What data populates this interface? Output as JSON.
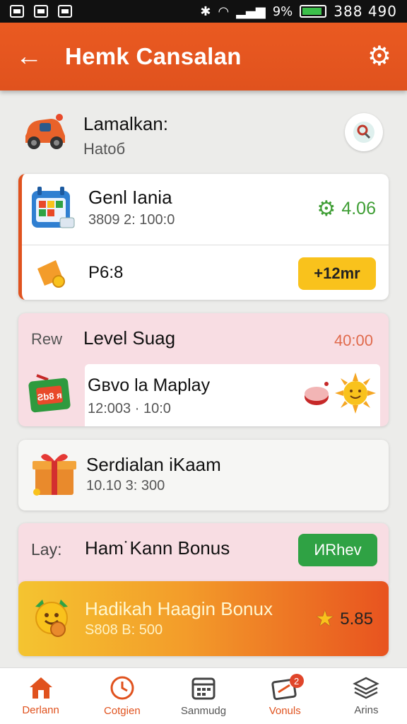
{
  "status_bar": {
    "battery_text": "9%",
    "time": "388 490",
    "battery_level": 0.9
  },
  "app_bar": {
    "title": "Hemk Cansalan",
    "back_icon": "arrow-left-icon",
    "settings_icon": "gear-icon"
  },
  "profile": {
    "name": "Lamalkan:",
    "subtitle": "Hatoб"
  },
  "cards": {
    "c1": {
      "title": "Genl Iania",
      "subtitle": "3809 2: 100:0",
      "score": "4.06",
      "reward_label": "P6:8",
      "reward_button": "+12mr"
    },
    "c2": {
      "tag": "Rew",
      "title": "Level Suag",
      "time": "40:00",
      "inner_title": "Gвvo la Maplay",
      "inner_subtitle": "12:003 · 10:0",
      "ticket_text": "Ƨb8 ᴙ"
    },
    "c3": {
      "title": "Serdialan iKaam",
      "subtitle": "10.10 3: 300"
    },
    "c4": {
      "tag": "Lay:",
      "title": "Ham˙Kann Bonus",
      "button": "ИRhev"
    },
    "c5": {
      "title": "Hadikah Haagin Bonux",
      "subtitle": "S808 B: 500",
      "score": "5.85"
    }
  },
  "bottom_nav": [
    {
      "label": "Derlann",
      "icon": "home-icon"
    },
    {
      "label": "Cotgien",
      "icon": "clock-icon"
    },
    {
      "label": "Sanmudg",
      "icon": "calendar-icon"
    },
    {
      "label": "Vonuls",
      "icon": "ticket-icon",
      "badge": "2"
    },
    {
      "label": "Arins",
      "icon": "layers-icon"
    }
  ],
  "colors": {
    "accent": "#e0521e",
    "green": "#2fa244",
    "yellow": "#f9c21c",
    "pink": "#f8dde3"
  }
}
